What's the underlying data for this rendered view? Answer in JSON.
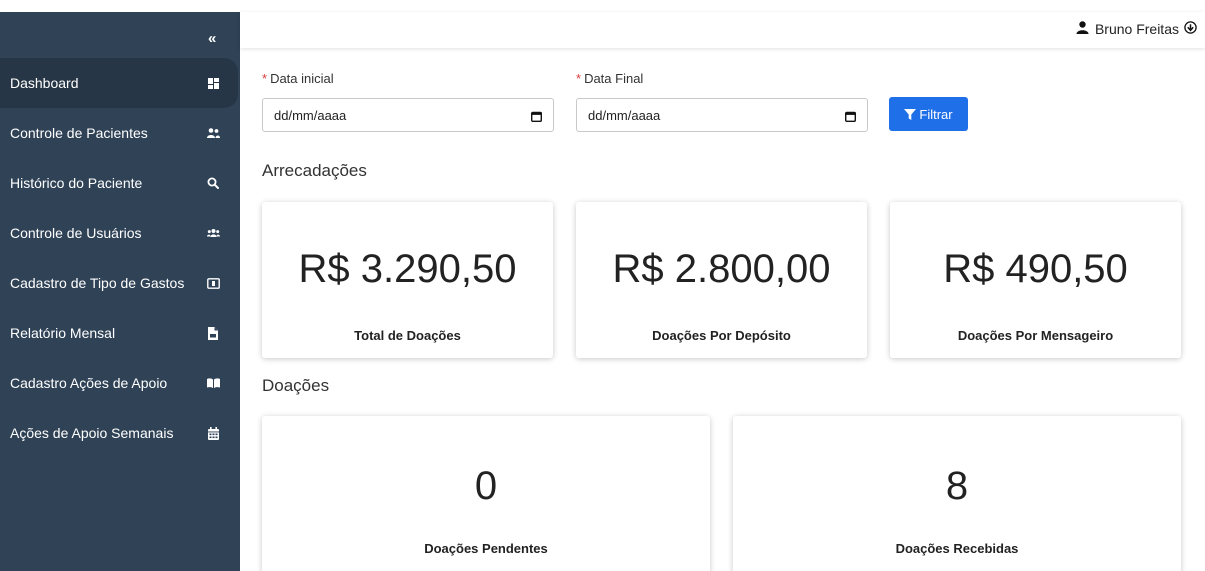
{
  "sidebar": {
    "collapse_label": "«",
    "items": [
      {
        "label": "Dashboard",
        "icon": "dashboard-icon"
      },
      {
        "label": "Controle de Pacientes",
        "icon": "users-icon"
      },
      {
        "label": "Histórico do Paciente",
        "icon": "search-icon"
      },
      {
        "label": "Controle de Usuários",
        "icon": "user-group-icon"
      },
      {
        "label": "Cadastro de Tipo de Gastos",
        "icon": "money-icon"
      },
      {
        "label": "Relatório Mensal",
        "icon": "file-pdf-icon"
      },
      {
        "label": "Cadastro Ações de Apoio",
        "icon": "book-open-icon"
      },
      {
        "label": "Ações de Apoio Semanais",
        "icon": "calendar-icon"
      }
    ],
    "active_index": 0,
    "colors": {
      "background": "#2f4256",
      "active": "#263646"
    }
  },
  "header": {
    "user_name": "Bruno Freitas"
  },
  "filters": {
    "required_mark": "*",
    "start_label": "Data inicial",
    "start_value": "dd/mm/aaaa",
    "end_label": "Data Final",
    "end_value": "dd/mm/aaaa",
    "button_label": "Filtrar",
    "button_color": "#1e6fe8"
  },
  "arrecadacoes": {
    "title": "Arrecadações",
    "cards": [
      {
        "value": "R$ 3.290,50",
        "label": "Total de Doações"
      },
      {
        "value": "R$ 2.800,00",
        "label": "Doações Por Depósito"
      },
      {
        "value": "R$ 490,50",
        "label": "Doações Por Mensageiro"
      }
    ]
  },
  "doacoes": {
    "title": "Doações",
    "cards": [
      {
        "value": "0",
        "label": "Doações Pendentes"
      },
      {
        "value": "8",
        "label": "Doações Recebidas"
      }
    ]
  }
}
